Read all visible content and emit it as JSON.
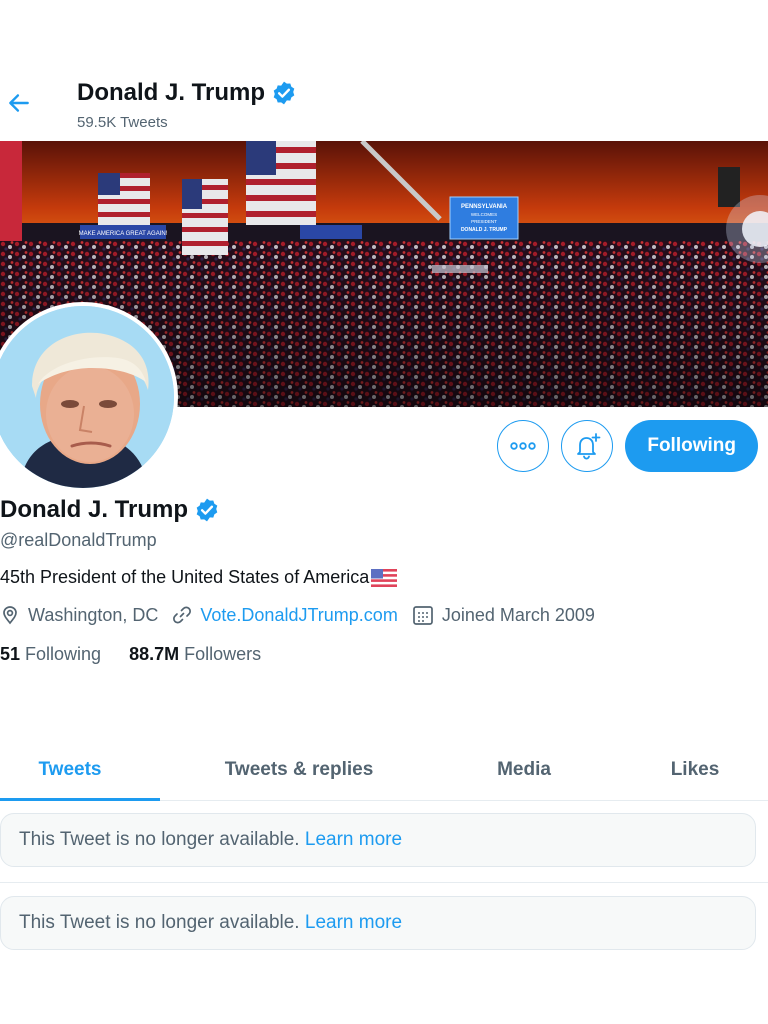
{
  "header": {
    "name": "Donald J. Trump",
    "tweet_count": "59.5K Tweets"
  },
  "profile": {
    "name": "Donald J. Trump",
    "handle": "@realDonaldTrump",
    "bio": "45th President of the United States of America",
    "location": "Washington, DC",
    "website": "Vote.DonaldJTrump.com",
    "joined": "Joined March 2009",
    "following_count": "51",
    "following_label": "Following",
    "followers_count": "88.7M",
    "followers_label": "Followers"
  },
  "actions": {
    "follow_label": "Following"
  },
  "banner": {
    "sign_text": [
      "PENNSYLVANIA",
      "WELCOMES",
      "PRESIDENT",
      "DONALD J. TRUMP"
    ],
    "banner_text": "MAKE AMERICA GREAT AGAIN!"
  },
  "tabs": [
    {
      "label": "Tweets",
      "active": true
    },
    {
      "label": "Tweets & replies",
      "active": false
    },
    {
      "label": "Media",
      "active": false
    },
    {
      "label": "Likes",
      "active": false
    }
  ],
  "tweets": [
    {
      "message": "This Tweet is no longer available.",
      "link": "Learn more"
    },
    {
      "message": "This Tweet is no longer available.",
      "link": "Learn more"
    }
  ],
  "icons": {
    "back": "arrow-left-icon",
    "verified": "verified-badge-icon",
    "more": "more-icon",
    "notify": "bell-plus-icon",
    "location": "location-pin-icon",
    "link": "link-icon",
    "calendar": "calendar-icon",
    "flag": "us-flag-icon"
  },
  "colors": {
    "accent": "#1d9bf0",
    "text": "#0f1419",
    "secondary": "#536471"
  }
}
